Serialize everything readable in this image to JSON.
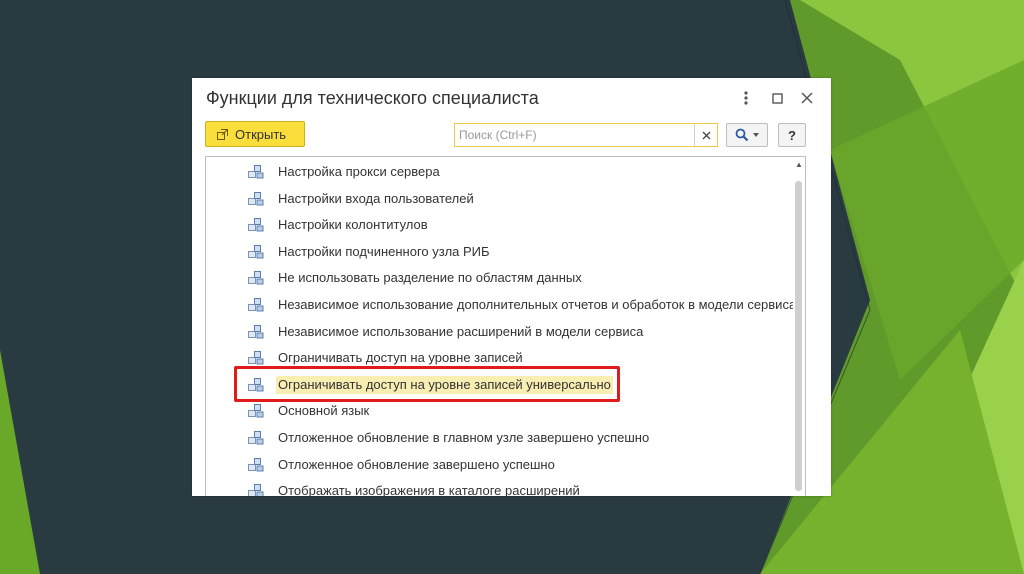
{
  "window": {
    "title": "Функции для технического специалиста",
    "menu_icon": "kebab-menu-icon",
    "maximize_icon": "maximize-icon",
    "close_icon": "close-icon"
  },
  "toolbar": {
    "open_label": "Открыть",
    "open_icon": "open-icon",
    "search_placeholder": "Поиск (Ctrl+F)",
    "search_value": "",
    "clear_icon": "clear-icon",
    "search_icon": "search-icon",
    "help_label": "?"
  },
  "list": {
    "items": [
      {
        "label": "Настройка прокси сервера",
        "selected": false
      },
      {
        "label": "Настройки входа пользователей",
        "selected": false
      },
      {
        "label": "Настройки колонтитулов",
        "selected": false
      },
      {
        "label": "Настройки подчиненного узла РИБ",
        "selected": false
      },
      {
        "label": "Не использовать разделение по областям данных",
        "selected": false
      },
      {
        "label": "Независимое использование дополнительных отчетов и обработок в модели сервиса",
        "selected": false
      },
      {
        "label": "Независимое использование расширений в модели сервиса",
        "selected": false
      },
      {
        "label": "Ограничивать доступ на уровне записей",
        "selected": false
      },
      {
        "label": "Ограничивать доступ на уровне записей универсально",
        "selected": true
      },
      {
        "label": "Основной язык",
        "selected": false
      },
      {
        "label": "Отложенное обновление в главном узле завершено успешно",
        "selected": false
      },
      {
        "label": "Отложенное обновление завершено успешно",
        "selected": false
      },
      {
        "label": "Отображать изображения в каталоге расширений",
        "selected": false
      }
    ]
  },
  "colors": {
    "background": "#2a3a41",
    "accent_green": "#7cb82f",
    "open_button": "#fadf3c",
    "selection": "#f9eeb1",
    "highlight_frame": "#e01b1b"
  }
}
